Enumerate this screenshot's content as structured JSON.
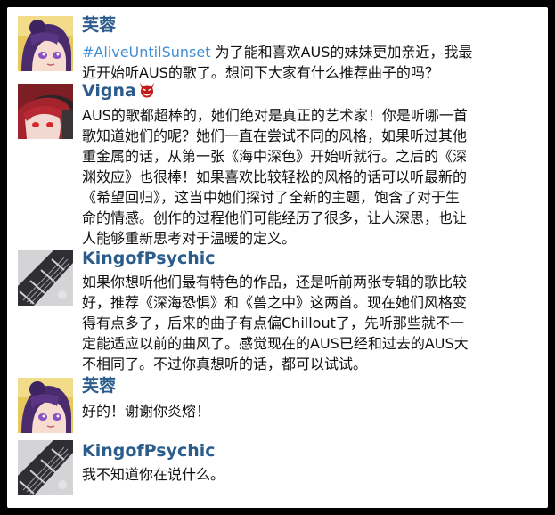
{
  "messages": [
    {
      "name": "芙蓉",
      "avatar": "purple-hair-girl-avatar",
      "hashtag": "#AliveUntilSunset",
      "lines": [
        "为了能和喜欢AUS的妹妹更加亲近，我最",
        "近开始听AUS的歌了。想问下大家有什么推荐曲子的吗？"
      ]
    },
    {
      "name": "Vigna",
      "avatar": "red-hair-girl-avatar",
      "name_icon": "devil-emoji-icon",
      "lines": [
        "AUS的歌都超棒的，她们绝对是真正的艺术家！你是听哪一首",
        "歌知道她们的呢？她们一直在尝试不同的风格，如果听过其他",
        "重金属的话，从第一张《海中深色》开始听就行。之后的《深",
        "渊效应》也很棒！如果喜欢比较轻松的风格的话可以听最新的",
        "《希望回归》，这当中她们探讨了全新的主题，饱含了对于生",
        "命的情感。创作的过程他们可能经历了很多，让人深思，也让",
        "人能够重新思考对于温暖的定义。"
      ]
    },
    {
      "name": "KingofPsychic",
      "avatar": "guitar-neck-avatar",
      "lines": [
        "如果你想听他们最有特色的作品，还是听前两张专辑的歌比较",
        "好，推荐《深海恐惧》和《兽之中》这两首。现在她们风格变",
        "得有点多了，后来的曲子有点偏Chillout了，先听那些就不一",
        "定能适应以前的曲风了。感觉现在的AUS已经和过去的AUS大",
        "不相同了。不过你真想听的话，都可以试试。"
      ]
    },
    {
      "name": "芙蓉",
      "avatar": "purple-hair-girl-avatar",
      "lines": [
        "好的！谢谢你炎熔！"
      ]
    },
    {
      "name": "KingofPsychic",
      "avatar": "guitar-neck-avatar",
      "lines": [
        "我不知道你在说什么。"
      ]
    }
  ],
  "colors": {
    "name": "#2b5c8c",
    "hashtag": "#3f8fd6",
    "text": "#111111",
    "frame_bg": "#ffffff",
    "outer_bg": "#000000"
  }
}
